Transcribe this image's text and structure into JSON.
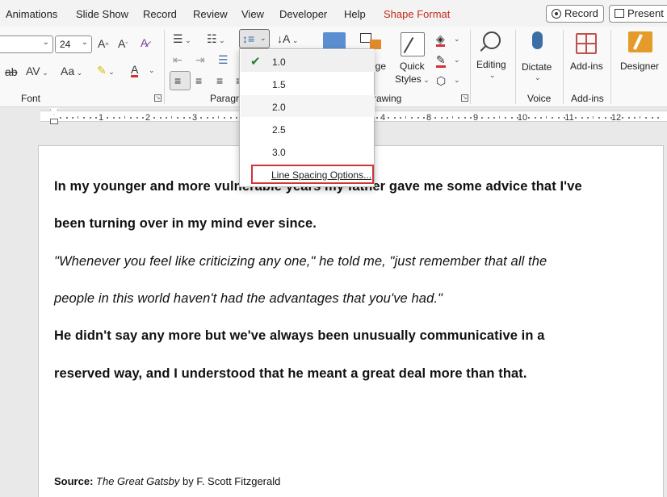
{
  "tabs": [
    "Animations",
    "Slide Show",
    "Record",
    "Review",
    "View",
    "Developer",
    "Help",
    "Shape Format"
  ],
  "title_buttons": {
    "record": "Record",
    "present": "Present in"
  },
  "font": {
    "name": "",
    "size": "24",
    "group_label": "Font"
  },
  "paragraph": {
    "group_label": "Paragra"
  },
  "drawing": {
    "arrange_label": "nge",
    "quick_styles": "Quick",
    "styles_label": "Styles",
    "group_label": "rawing"
  },
  "editing": {
    "label": "Editing"
  },
  "voice": {
    "dictate": "Dictate",
    "group_label": "Voice"
  },
  "addins": {
    "label": "Add-ins",
    "group_label": "Add-ins"
  },
  "designer": {
    "label": "Designer"
  },
  "ruler": {
    "numbers": [
      "1",
      "2",
      "3",
      "4",
      "8",
      "9",
      "10",
      "11",
      "12"
    ]
  },
  "line_spacing_menu": {
    "options": [
      "1.0",
      "1.5",
      "2.0",
      "2.5",
      "3.0"
    ],
    "selected": "1.0",
    "more_options": "Line Spacing Options..."
  },
  "document": {
    "p1_line1": "In my younger and more vulnerable years my father gave me some advice that I've",
    "p1_line2": "been turning over in my mind ever since.",
    "p2_line1": "\"Whenever you feel like criticizing any one,\" he told me, \"just remember that all the",
    "p2_line2": "people in this world haven't had the advantages that you've had.\"",
    "p3_line1": "He didn't say any more but we've always been unusually communicative in a",
    "p3_line2": "reserved way, and I understood that he meant a great deal more than that.",
    "source_label": "Source:",
    "source_title": "The Great Gatsby",
    "source_author": "by F. Scott Fitzgerald"
  },
  "colors": {
    "accent_tab": "#c42b1c",
    "highlight_box": "#d13438",
    "check": "#2d7d32"
  }
}
